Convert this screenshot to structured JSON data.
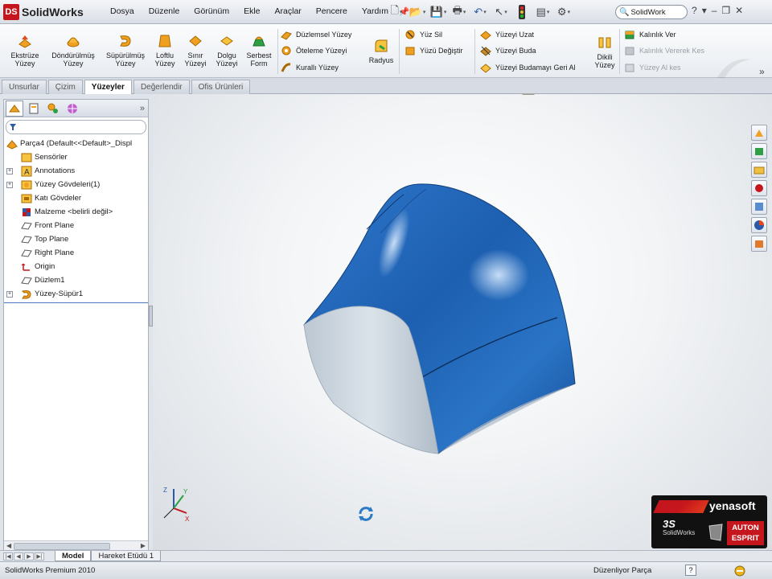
{
  "app": {
    "logo_text": "SolidWorks",
    "logo_badge": "DS",
    "colors": {
      "accent": "#c4161c",
      "model_blue": "#1f5fae",
      "tree_blue": "#4a78c2"
    }
  },
  "menu": {
    "items": [
      "Dosya",
      "Düzenle",
      "Görünüm",
      "Ekle",
      "Araçlar",
      "Pencere",
      "Yardım"
    ],
    "pin_icon": "pushpin-icon"
  },
  "search": {
    "value": "SolidWork",
    "icon": "search-icon"
  },
  "title_right": {
    "help": "?",
    "dropdown": "▾",
    "minimize": "–",
    "restore": "❐",
    "close": "✕"
  },
  "ribbon": {
    "big_buttons": [
      {
        "label": "Ekstrüze\nYüzey"
      },
      {
        "label": "Döndürülmüş\nYüzey"
      },
      {
        "label": "Süpürülmüş\nYüzey"
      },
      {
        "label": "Loftlu\nYüzey"
      },
      {
        "label": "Sınır\nYüzeyi"
      },
      {
        "label": "Dolgu\nYüzeyi"
      },
      {
        "label": "Serbest\nForm"
      }
    ],
    "col1": [
      "Düzlemsel Yüzey",
      "Öteleme Yüzeyi",
      "Kurallı Yüzey"
    ],
    "radius_label": "Radyus",
    "col2": [
      "Yüz Sil",
      "Yüzü Değiştir"
    ],
    "col3": [
      "Yüzeyi Uzat",
      "Yüzeyi Buda",
      "Yüzeyi Budamayı Geri Al"
    ],
    "knit_label": "Dikili\nYüzey",
    "col4": [
      "Kalınlık Ver",
      "Kalınlık Vererek Kes",
      "Yüzey Al kes"
    ],
    "more": "»"
  },
  "tabs": [
    {
      "label": "Unsurlar",
      "active": false
    },
    {
      "label": "Çizim",
      "active": false
    },
    {
      "label": "Yüzeyler",
      "active": true
    },
    {
      "label": "Değerlendir",
      "active": false
    },
    {
      "label": "Ofis Ürünleri",
      "active": false
    }
  ],
  "tree": {
    "root": "Parça4  (Default<<Default>_Displ",
    "items": [
      {
        "label": "Sensörler",
        "expandable": false
      },
      {
        "label": "Annotations",
        "expandable": true
      },
      {
        "label": "Yüzey Gövdeleri(1)",
        "expandable": true
      },
      {
        "label": "Katı Gövdeler",
        "expandable": false
      },
      {
        "label": "Malzeme <belirli değil>",
        "expandable": false
      },
      {
        "label": "Front Plane",
        "expandable": false
      },
      {
        "label": "Top Plane",
        "expandable": false
      },
      {
        "label": "Right Plane",
        "expandable": false
      },
      {
        "label": "Origin",
        "expandable": false
      },
      {
        "label": "Düzlem1",
        "expandable": false
      },
      {
        "label": "Yüzey-Süpür1",
        "expandable": true
      }
    ],
    "more": "»"
  },
  "bottom_tabs": [
    {
      "label": "Model",
      "active": true
    },
    {
      "label": "Hareket Etüdü 1",
      "active": false
    }
  ],
  "status": {
    "left": "SolidWorks Premium 2010",
    "right": "Düzenliyor Parça",
    "help": "?"
  },
  "badge": {
    "brand": "yenasoft",
    "ds": "3S",
    "sw": "SolidWorks",
    "auton_line1": "AUTON",
    "auton_line2": "ESPRIT"
  },
  "triad": {
    "z": "Z",
    "y": "Y",
    "x": "X"
  }
}
